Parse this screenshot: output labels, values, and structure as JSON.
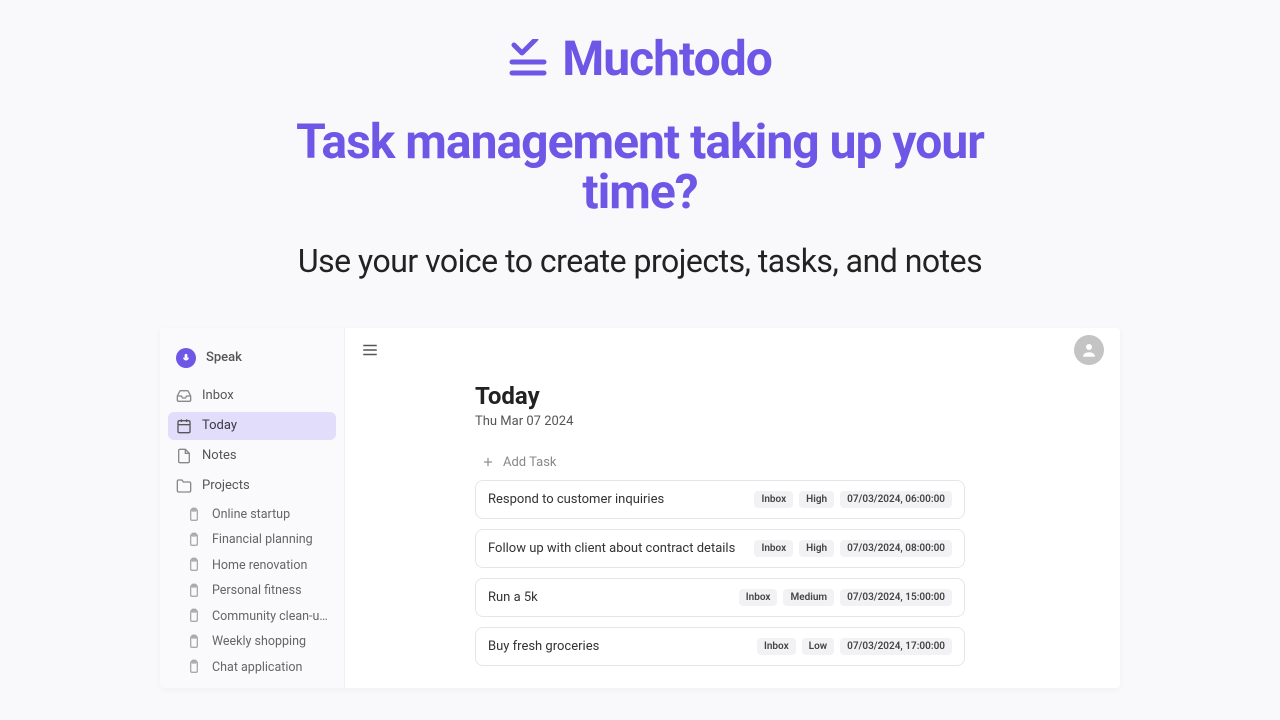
{
  "brand": {
    "name": "Muchtodo"
  },
  "hero": {
    "headline_l1": "Task management taking up your",
    "headline_l2": "time?",
    "subhead": "Use your voice to create projects, tasks, and notes"
  },
  "sidebar": {
    "speak_label": "Speak",
    "nav": [
      {
        "icon": "inbox",
        "label": "Inbox",
        "active": false
      },
      {
        "icon": "calendar",
        "label": "Today",
        "active": true
      },
      {
        "icon": "note",
        "label": "Notes",
        "active": false
      },
      {
        "icon": "folder",
        "label": "Projects",
        "active": false
      }
    ],
    "projects": [
      "Online startup",
      "Financial planning",
      "Home renovation",
      "Personal fitness",
      "Community clean-up ini...",
      "Weekly shopping",
      "Chat application"
    ]
  },
  "main": {
    "title": "Today",
    "date": "Thu Mar 07 2024",
    "add_task_label": "Add Task",
    "tasks": [
      {
        "title": "Respond to customer inquiries",
        "list": "Inbox",
        "priority": "High",
        "due": "07/03/2024, 06:00:00"
      },
      {
        "title": "Follow up with client about contract details",
        "list": "Inbox",
        "priority": "High",
        "due": "07/03/2024, 08:00:00"
      },
      {
        "title": "Run a 5k",
        "list": "Inbox",
        "priority": "Medium",
        "due": "07/03/2024, 15:00:00"
      },
      {
        "title": "Buy fresh groceries",
        "list": "Inbox",
        "priority": "Low",
        "due": "07/03/2024, 17:00:00"
      }
    ]
  }
}
